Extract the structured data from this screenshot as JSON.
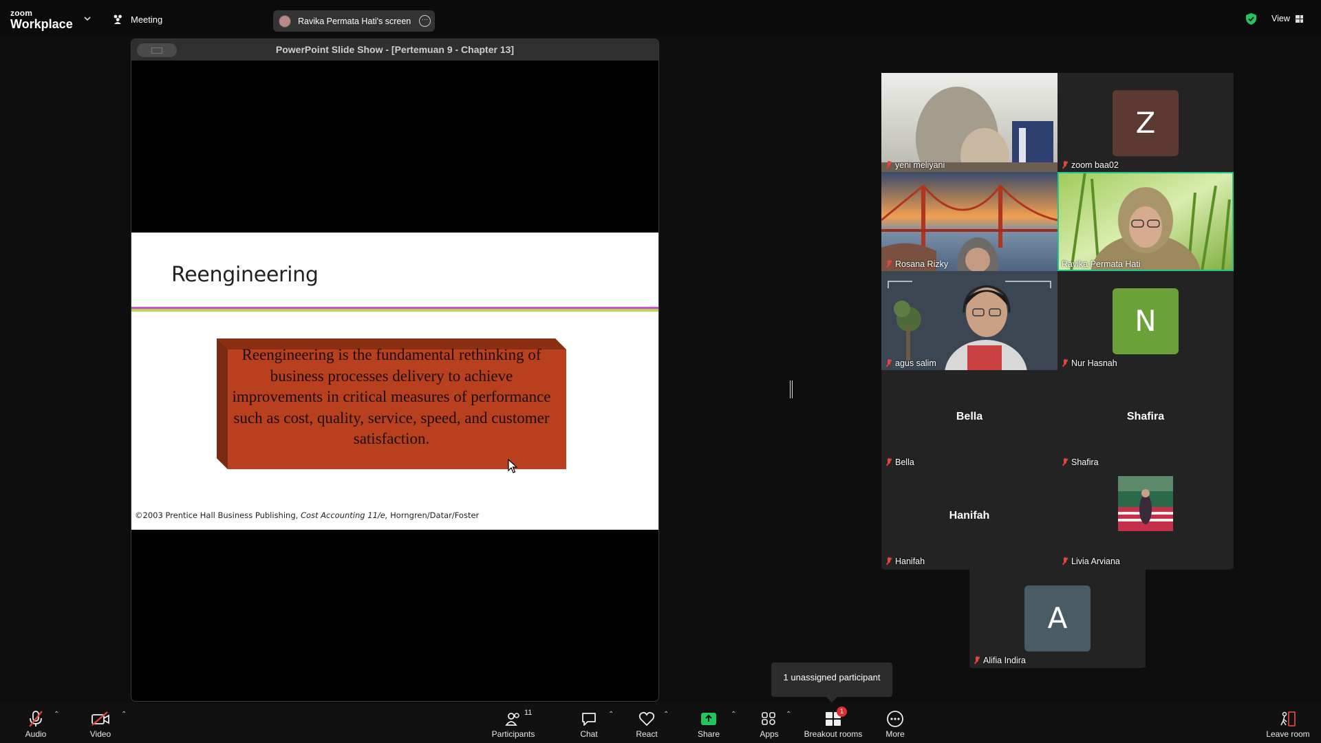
{
  "app": {
    "logo_small": "zoom",
    "logo_big": "Workplace"
  },
  "topbar": {
    "meeting_label": "Meeting",
    "screen_pill_label": "Ravika Permata Hati's screen",
    "view_label": "View",
    "colors": {
      "shield": "#22c55e"
    }
  },
  "share": {
    "window_title": "PowerPoint Slide Show - [Pertemuan 9 - Chapter 13]",
    "slide": {
      "title": "Reengineering",
      "body": "Reengineering is the fundamental rethinking of business processes delivery to achieve improvements in critical measures of performance such as cost, quality, service, speed, and customer satisfaction.",
      "footer_prefix": "©2003 Prentice Hall Business Publishing, ",
      "footer_book": "Cost Accounting 11/e,",
      "footer_suffix": " Horngren/Datar/Foster",
      "colors": {
        "box": "#b8401f",
        "line_top": "#c74dd6",
        "line_bottom": "#b6d94a"
      }
    }
  },
  "gallery": {
    "tiles": [
      {
        "name": "yeni meliyani",
        "type": "video"
      },
      {
        "name": "zoom baa02",
        "type": "initial",
        "initial": "Z",
        "color": "#5c3a33"
      },
      {
        "name": "Rosana Rizky",
        "type": "video"
      },
      {
        "name": "Ravika Permata Hati",
        "type": "video",
        "active": true
      },
      {
        "name": "agus salim",
        "type": "video"
      },
      {
        "name": "Nur Hasnah",
        "type": "initial",
        "initial": "N",
        "color": "#6aa138"
      },
      {
        "name": "Bella",
        "type": "name",
        "display": "Bella"
      },
      {
        "name": "Shafira",
        "type": "name",
        "display": "Shafira"
      },
      {
        "name": "Hanifah",
        "type": "name",
        "display": "Hanifah"
      },
      {
        "name": "Livia Arviana",
        "type": "photo"
      },
      {
        "name": "Alifia Indira",
        "type": "initial",
        "initial": "A",
        "color": "#4a5b66"
      }
    ]
  },
  "tooltip": {
    "text": "1 unassigned participant"
  },
  "toolbar": {
    "audio": "Audio",
    "video": "Video",
    "participants": "Participants",
    "participants_count": "11",
    "chat": "Chat",
    "react": "React",
    "share": "Share",
    "apps": "Apps",
    "breakout": "Breakout rooms",
    "breakout_badge": "1",
    "more": "More",
    "leave": "Leave room",
    "colors": {
      "share_green": "#22c55e",
      "muted_red": "#e0443e"
    }
  }
}
